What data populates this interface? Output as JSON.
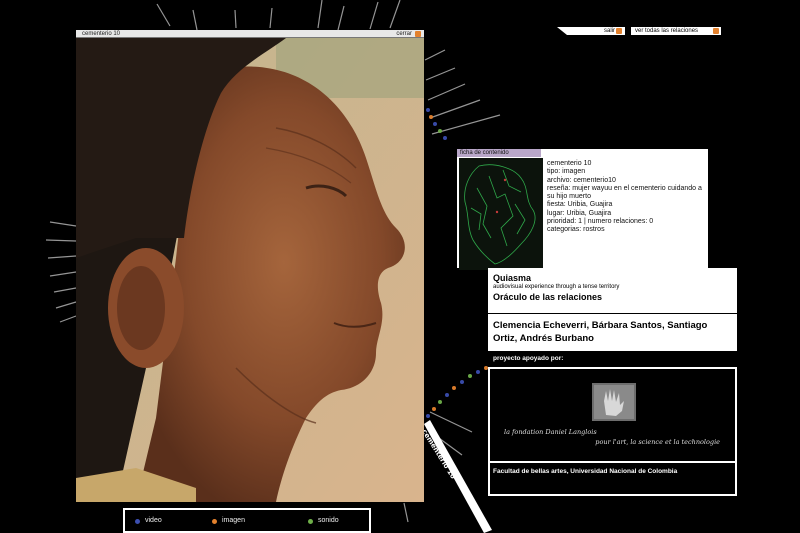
{
  "image_window": {
    "title": "cementerio 10",
    "close_label": "cerrar"
  },
  "top_bar": {
    "exit_label": "salir",
    "all_relations_label": "ver todas las relaciones"
  },
  "ficha": {
    "tab_label": "ficha de contenido",
    "lines": [
      "cementerio 10",
      "tipo: imagen",
      "archivo: cementerio10",
      "reseña: mujer wayuu en el cementerio cuidando a",
      "su hijo muerto",
      "fiesta: Uribia, Guajira",
      "lugar: Uribia, Guajira",
      "prioridad: 1  |  numero relaciones: 0",
      "categorias: rostros"
    ]
  },
  "credits": {
    "title": "Quiasma",
    "subtitle": "audiovisual experience through a tense territory",
    "oracle": "Oráculo de las relaciones",
    "authors": "Clemencia Echeverri, Bárbara Santos, Santiago Ortiz, Andrés Burbano",
    "support_label": "proyecto apoyado por:",
    "fondation_line1": "la fondation Daniel Langlois",
    "fondation_line2": "pour l'art, la science et la technologie",
    "university": "Facultad de bellas artes, Universidad Nacional de Colombia"
  },
  "legend": {
    "items": [
      {
        "label": "video",
        "color": "#3c4fb0"
      },
      {
        "label": "imagen",
        "color": "#e3812d"
      },
      {
        "label": "sonido",
        "color": "#6fb04a"
      }
    ]
  },
  "wheel_label": "cementerio 10",
  "colors": {
    "accent_orange": "#e3812d",
    "tab_lilac": "#b9a7c9",
    "map_green": "#2fa84a"
  }
}
